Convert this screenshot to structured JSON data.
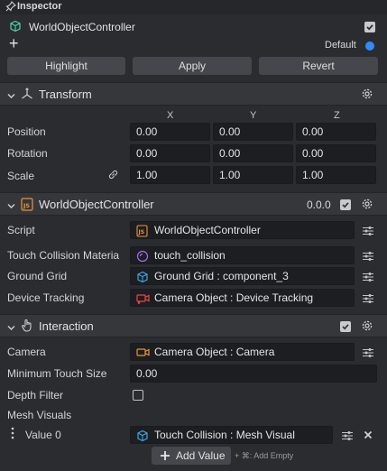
{
  "panel": {
    "title": "Inspector"
  },
  "object": {
    "name": "WorldObjectController",
    "enabled": true
  },
  "header": {
    "add_label": "+",
    "layer_label": "Default",
    "layer_color": "#2f8cff"
  },
  "buttons": {
    "highlight": "Highlight",
    "apply": "Apply",
    "revert": "Revert"
  },
  "transform": {
    "title": "Transform",
    "axes": [
      "X",
      "Y",
      "Z"
    ],
    "rows": [
      {
        "label": "Position",
        "values": [
          "0.00",
          "0.00",
          "0.00"
        ]
      },
      {
        "label": "Rotation",
        "values": [
          "0.00",
          "0.00",
          "0.00"
        ]
      },
      {
        "label": "Scale",
        "values": [
          "1.00",
          "1.00",
          "1.00"
        ]
      }
    ]
  },
  "script_component": {
    "title": "WorldObjectController",
    "version": "0.0.0",
    "fields": [
      {
        "label": "Script",
        "value": "WorldObjectController",
        "icon": "js-file-icon"
      },
      {
        "label": "Touch Collision Materia",
        "value": "touch_collision",
        "icon": "material-icon"
      },
      {
        "label": "Ground Grid",
        "value": "Ground Grid : component_3",
        "icon": "mesh-cube-icon"
      },
      {
        "label": "Device Tracking",
        "value": "Camera Object : Device Tracking",
        "icon": "camera-tracking-icon"
      }
    ]
  },
  "interaction": {
    "title": "Interaction",
    "camera": {
      "label": "Camera",
      "value": "Camera Object : Camera"
    },
    "min_touch": {
      "label": "Minimum Touch Size",
      "value": "0.00"
    },
    "depth_filter": {
      "label": "Depth Filter",
      "checked": false
    },
    "mesh_visuals": {
      "label": "Mesh Visuals"
    },
    "value0": {
      "label": "Value 0",
      "value": "Touch Collision : Mesh Visual"
    },
    "add_value": "Add Value",
    "hint": "+ ⌘: Add Empty"
  },
  "colors": {
    "accent_orange": "#e8933a",
    "accent_blue": "#3ea7e8",
    "accent_purple": "#a66cf0",
    "accent_red": "#e8474a"
  }
}
